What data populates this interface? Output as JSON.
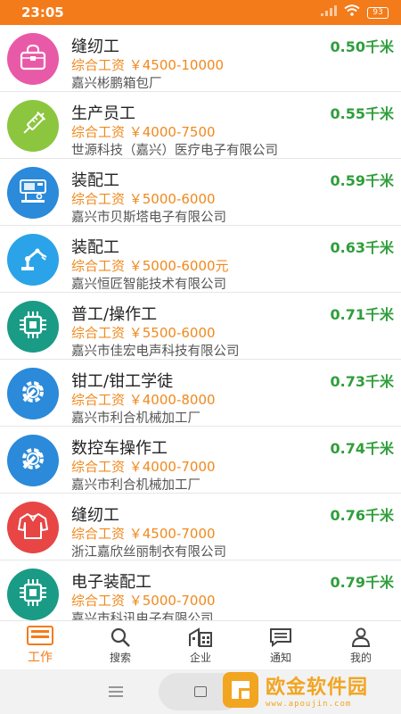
{
  "status_bar": {
    "time": "23:05",
    "battery": "93",
    "icons": [
      "signal-icon",
      "wifi-icon",
      "battery-icon"
    ]
  },
  "jobs": [
    {
      "title": "缝纫工",
      "salary": "综合工资 ￥4500-10000",
      "company": "嘉兴彬鹏箱包厂",
      "distance": "0.50千米",
      "icon": "handbag-icon",
      "icon_bg": "#e85aa8"
    },
    {
      "title": "生产员工",
      "salary": "综合工资 ￥4000-7500",
      "company": "世源科技（嘉兴）医疗电子有限公司",
      "distance": "0.55千米",
      "icon": "syringe-icon",
      "icon_bg": "#8cc63f"
    },
    {
      "title": "装配工",
      "salary": "综合工资 ￥5000-6000",
      "company": "嘉兴市贝斯塔电子有限公司",
      "distance": "0.59千米",
      "icon": "machine-icon",
      "icon_bg": "#2b8ad9"
    },
    {
      "title": "装配工",
      "salary": "综合工资 ￥5000-6000元",
      "company": "嘉兴恒匠智能技术有限公司",
      "distance": "0.63千米",
      "icon": "robot-arm-icon",
      "icon_bg": "#2aa3e8"
    },
    {
      "title": "普工/操作工",
      "salary": "综合工资 ￥5500-6000",
      "company": "嘉兴市佳宏电声科技有限公司",
      "distance": "0.71千米",
      "icon": "chip-icon",
      "icon_bg": "#1a9b86"
    },
    {
      "title": "钳工/钳工学徒",
      "salary": "综合工资 ￥4000-8000",
      "company": "嘉兴市利合机械加工厂",
      "distance": "0.73千米",
      "icon": "wrench-gear-icon",
      "icon_bg": "#2b8ad9"
    },
    {
      "title": "数控车操作工",
      "salary": "综合工资 ￥4000-7000",
      "company": "嘉兴市利合机械加工厂",
      "distance": "0.74千米",
      "icon": "wrench-gear-icon",
      "icon_bg": "#2b8ad9"
    },
    {
      "title": "缝纫工",
      "salary": "综合工资 ￥4500-7000",
      "company": "浙江嘉欣丝丽制衣有限公司",
      "distance": "0.76千米",
      "icon": "shirt-icon",
      "icon_bg": "#e84545"
    },
    {
      "title": "电子装配工",
      "salary": "综合工资 ￥5000-7000",
      "company": "嘉兴市科讯电子有限公司",
      "distance": "0.79千米",
      "icon": "chip-icon",
      "icon_bg": "#1a9b86"
    }
  ],
  "tabs": [
    {
      "label": "工作",
      "icon": "work-icon",
      "active": true
    },
    {
      "label": "搜索",
      "icon": "search-icon",
      "active": false
    },
    {
      "label": "企业",
      "icon": "building-icon",
      "active": false
    },
    {
      "label": "通知",
      "icon": "message-icon",
      "active": false
    },
    {
      "label": "我的",
      "icon": "user-icon",
      "active": false
    }
  ],
  "watermark": {
    "title": "欧金软件园",
    "url": "www.apoujin.com"
  },
  "colors": {
    "accent": "#f47b1a",
    "distance": "#2f9e3b",
    "salary": "#f0891e"
  }
}
